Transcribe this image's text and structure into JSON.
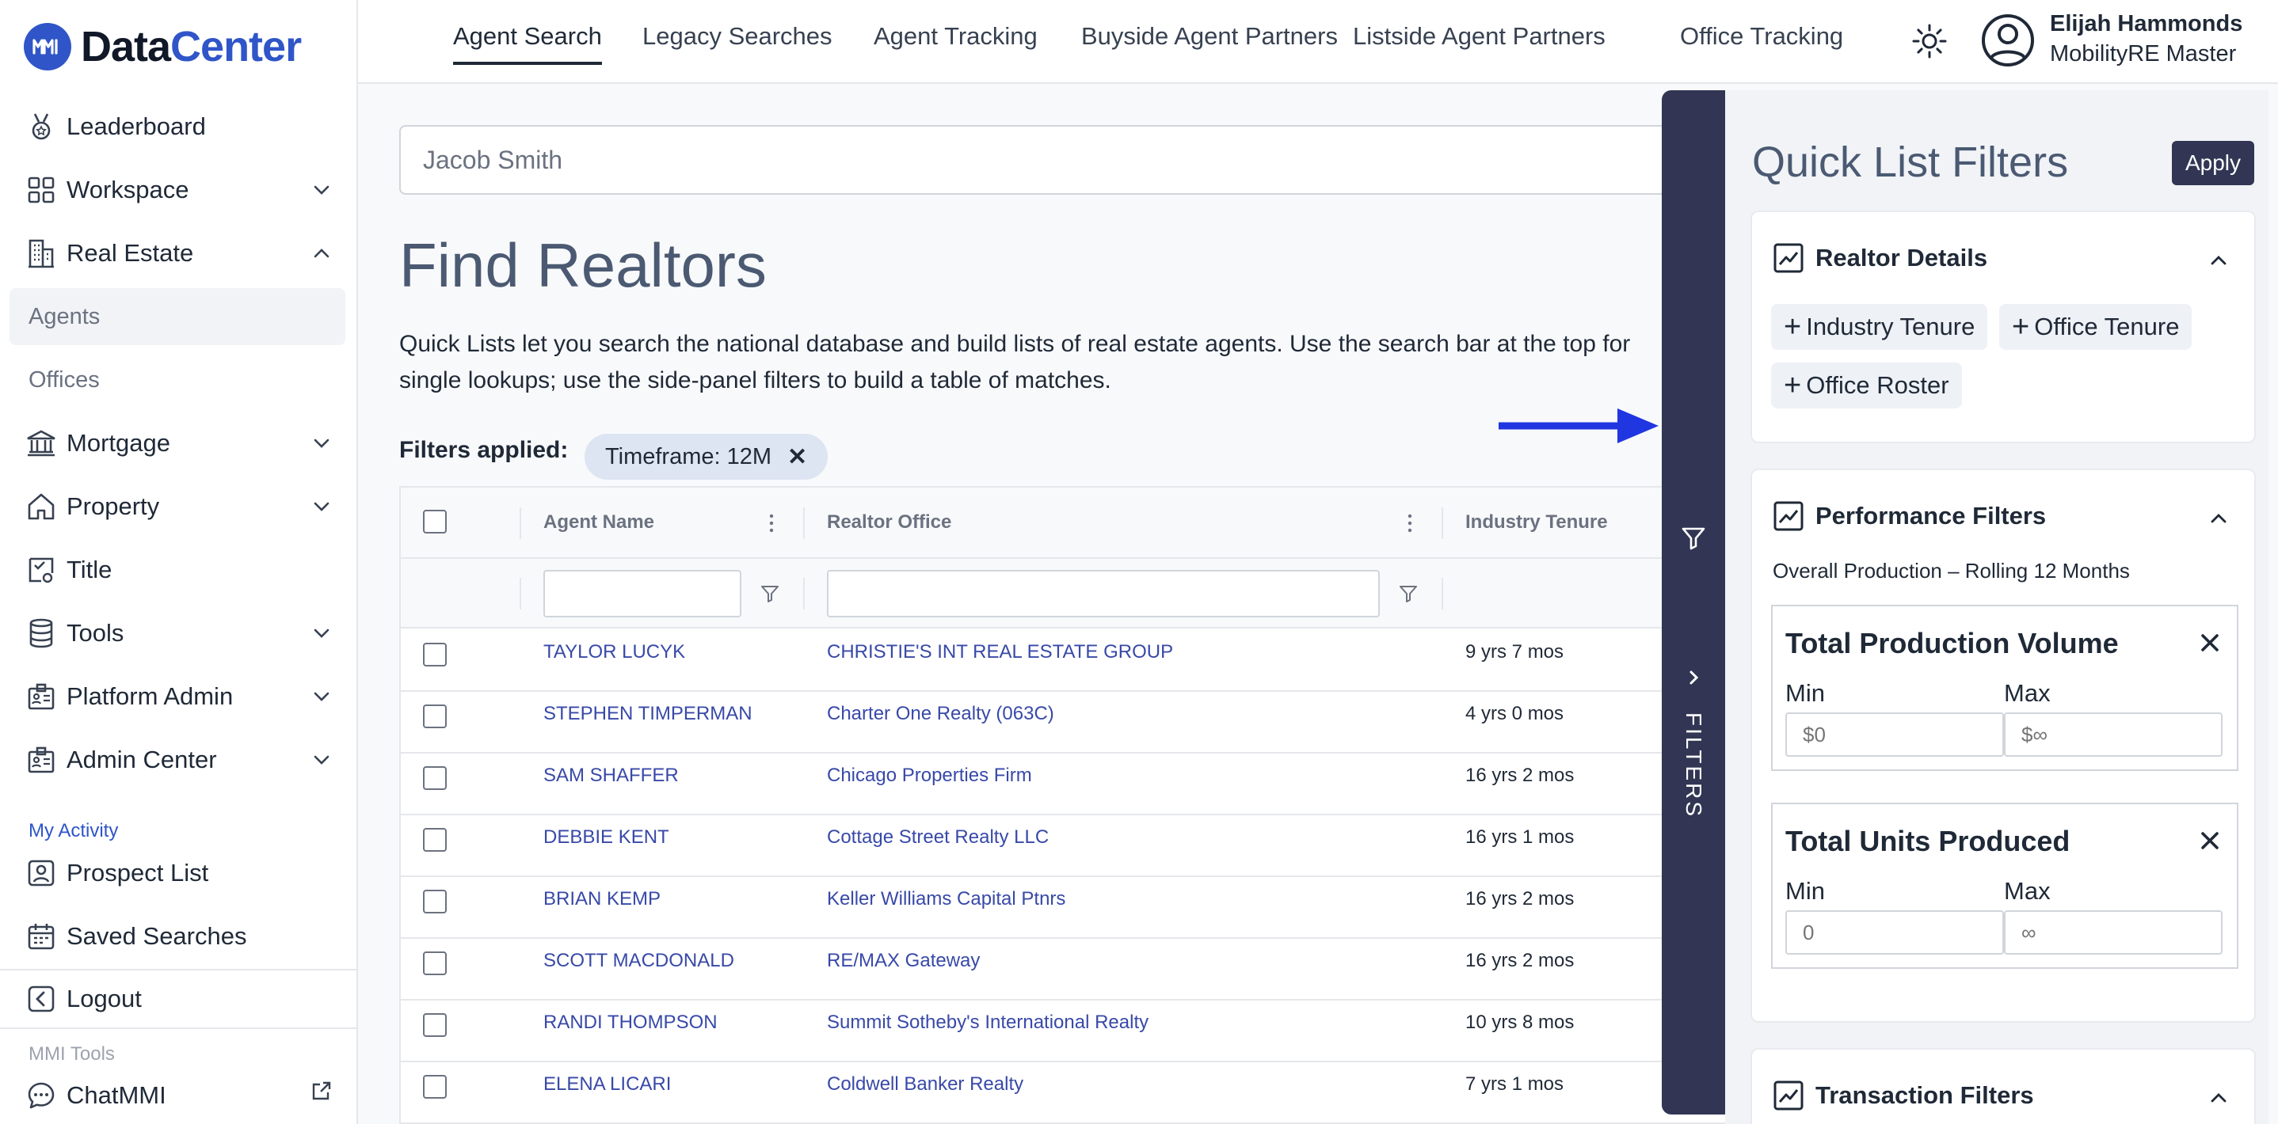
{
  "brand": {
    "logo_prefix": "Data",
    "logo_suffix": "Center",
    "logo_mark": "MMI"
  },
  "sidebar": {
    "items": [
      {
        "label": "Leaderboard",
        "icon": "medal-icon"
      },
      {
        "label": "Workspace",
        "icon": "grid-icon",
        "expanded": false
      },
      {
        "label": "Real Estate",
        "icon": "building-icon",
        "expanded": true
      },
      {
        "label": "Mortgage",
        "icon": "bank-icon",
        "expanded": false
      },
      {
        "label": "Property",
        "icon": "home-icon",
        "expanded": false
      },
      {
        "label": "Title",
        "icon": "certificate-icon"
      },
      {
        "label": "Tools",
        "icon": "database-icon",
        "expanded": false
      },
      {
        "label": "Platform Admin",
        "icon": "admin-icon",
        "expanded": false
      },
      {
        "label": "Admin Center",
        "icon": "admin-icon",
        "expanded": false
      }
    ],
    "real_estate_sub": [
      {
        "label": "Agents",
        "active": true
      },
      {
        "label": "Offices",
        "active": false
      }
    ],
    "my_activity_label": "My Activity",
    "activity_items": [
      {
        "label": "Prospect List",
        "icon": "user-box-icon"
      },
      {
        "label": "Saved Searches",
        "icon": "calendar-icon"
      }
    ],
    "logout_label": "Logout",
    "mmi_tools_label": "MMI Tools",
    "chat_label": "ChatMMI"
  },
  "topnav": {
    "tabs": [
      {
        "label": "Agent Search",
        "active": true
      },
      {
        "label": "Legacy Searches",
        "active": false
      },
      {
        "label": "Agent Tracking",
        "active": false
      },
      {
        "label": "Buyside Agent Partners",
        "active": false
      },
      {
        "label": "Listside Agent Partners",
        "active": false
      },
      {
        "label": "Office Tracking",
        "active": false
      }
    ],
    "user": {
      "name": "Elijah Hammonds",
      "role": "MobilityRE Master"
    }
  },
  "main": {
    "search_value": "Jacob Smith",
    "title": "Find Realtors",
    "description": "Quick Lists let you search the national database and build lists of real estate agents. Use the search bar at the top for single lookups; use the side-panel filters to build a table of matches.",
    "filters_applied_label": "Filters applied:",
    "chip_label": "Timeframe: 12M",
    "chip_close": "✕"
  },
  "table": {
    "columns": [
      "Agent Name",
      "Realtor Office",
      "Industry Tenure"
    ],
    "rows": [
      {
        "agent": "TAYLOR LUCYK",
        "office": "CHRISTIE'S INT REAL ESTATE GROUP",
        "tenure": "9 yrs 7 mos"
      },
      {
        "agent": "STEPHEN TIMPERMAN",
        "office": "Charter One Realty (063C)",
        "tenure": "4 yrs 0 mos"
      },
      {
        "agent": "SAM SHAFFER",
        "office": "Chicago Properties Firm",
        "tenure": "16 yrs 2 mos"
      },
      {
        "agent": "DEBBIE KENT",
        "office": "Cottage Street Realty LLC",
        "tenure": "16 yrs 1 mos"
      },
      {
        "agent": "BRIAN KEMP",
        "office": "Keller Williams Capital Ptnrs",
        "tenure": "16 yrs 2 mos"
      },
      {
        "agent": "SCOTT MACDONALD",
        "office": "RE/MAX Gateway",
        "tenure": "16 yrs 2 mos"
      },
      {
        "agent": "RANDI THOMPSON",
        "office": "Summit Sotheby's International Realty",
        "tenure": "10 yrs 8 mos"
      },
      {
        "agent": "ELENA LICARI",
        "office": "Coldwell Banker Realty",
        "tenure": "7 yrs 1 mos"
      }
    ]
  },
  "filters_panel": {
    "tab_label": "FILTERS",
    "title": "Quick List Filters",
    "apply_label": "Apply",
    "realtor_details": {
      "title": "Realtor Details",
      "pills": [
        "Industry Tenure",
        "Office Tenure",
        "Office Roster"
      ]
    },
    "performance": {
      "title": "Performance Filters",
      "subtitle": "Overall Production – Rolling 12 Months",
      "metrics": [
        {
          "title": "Total Production Volume",
          "min_label": "Min",
          "max_label": "Max",
          "min_placeholder": "$0",
          "max_placeholder": "$∞"
        },
        {
          "title": "Total Units Produced",
          "min_label": "Min",
          "max_label": "Max",
          "min_placeholder": "0",
          "max_placeholder": "∞"
        }
      ]
    },
    "transaction": {
      "title": "Transaction Filters"
    }
  },
  "colors": {
    "brand_blue": "#2f55c8",
    "drawer_navy": "#323654",
    "link_blue": "#3849a8",
    "arrow_blue": "#1f36e0"
  }
}
